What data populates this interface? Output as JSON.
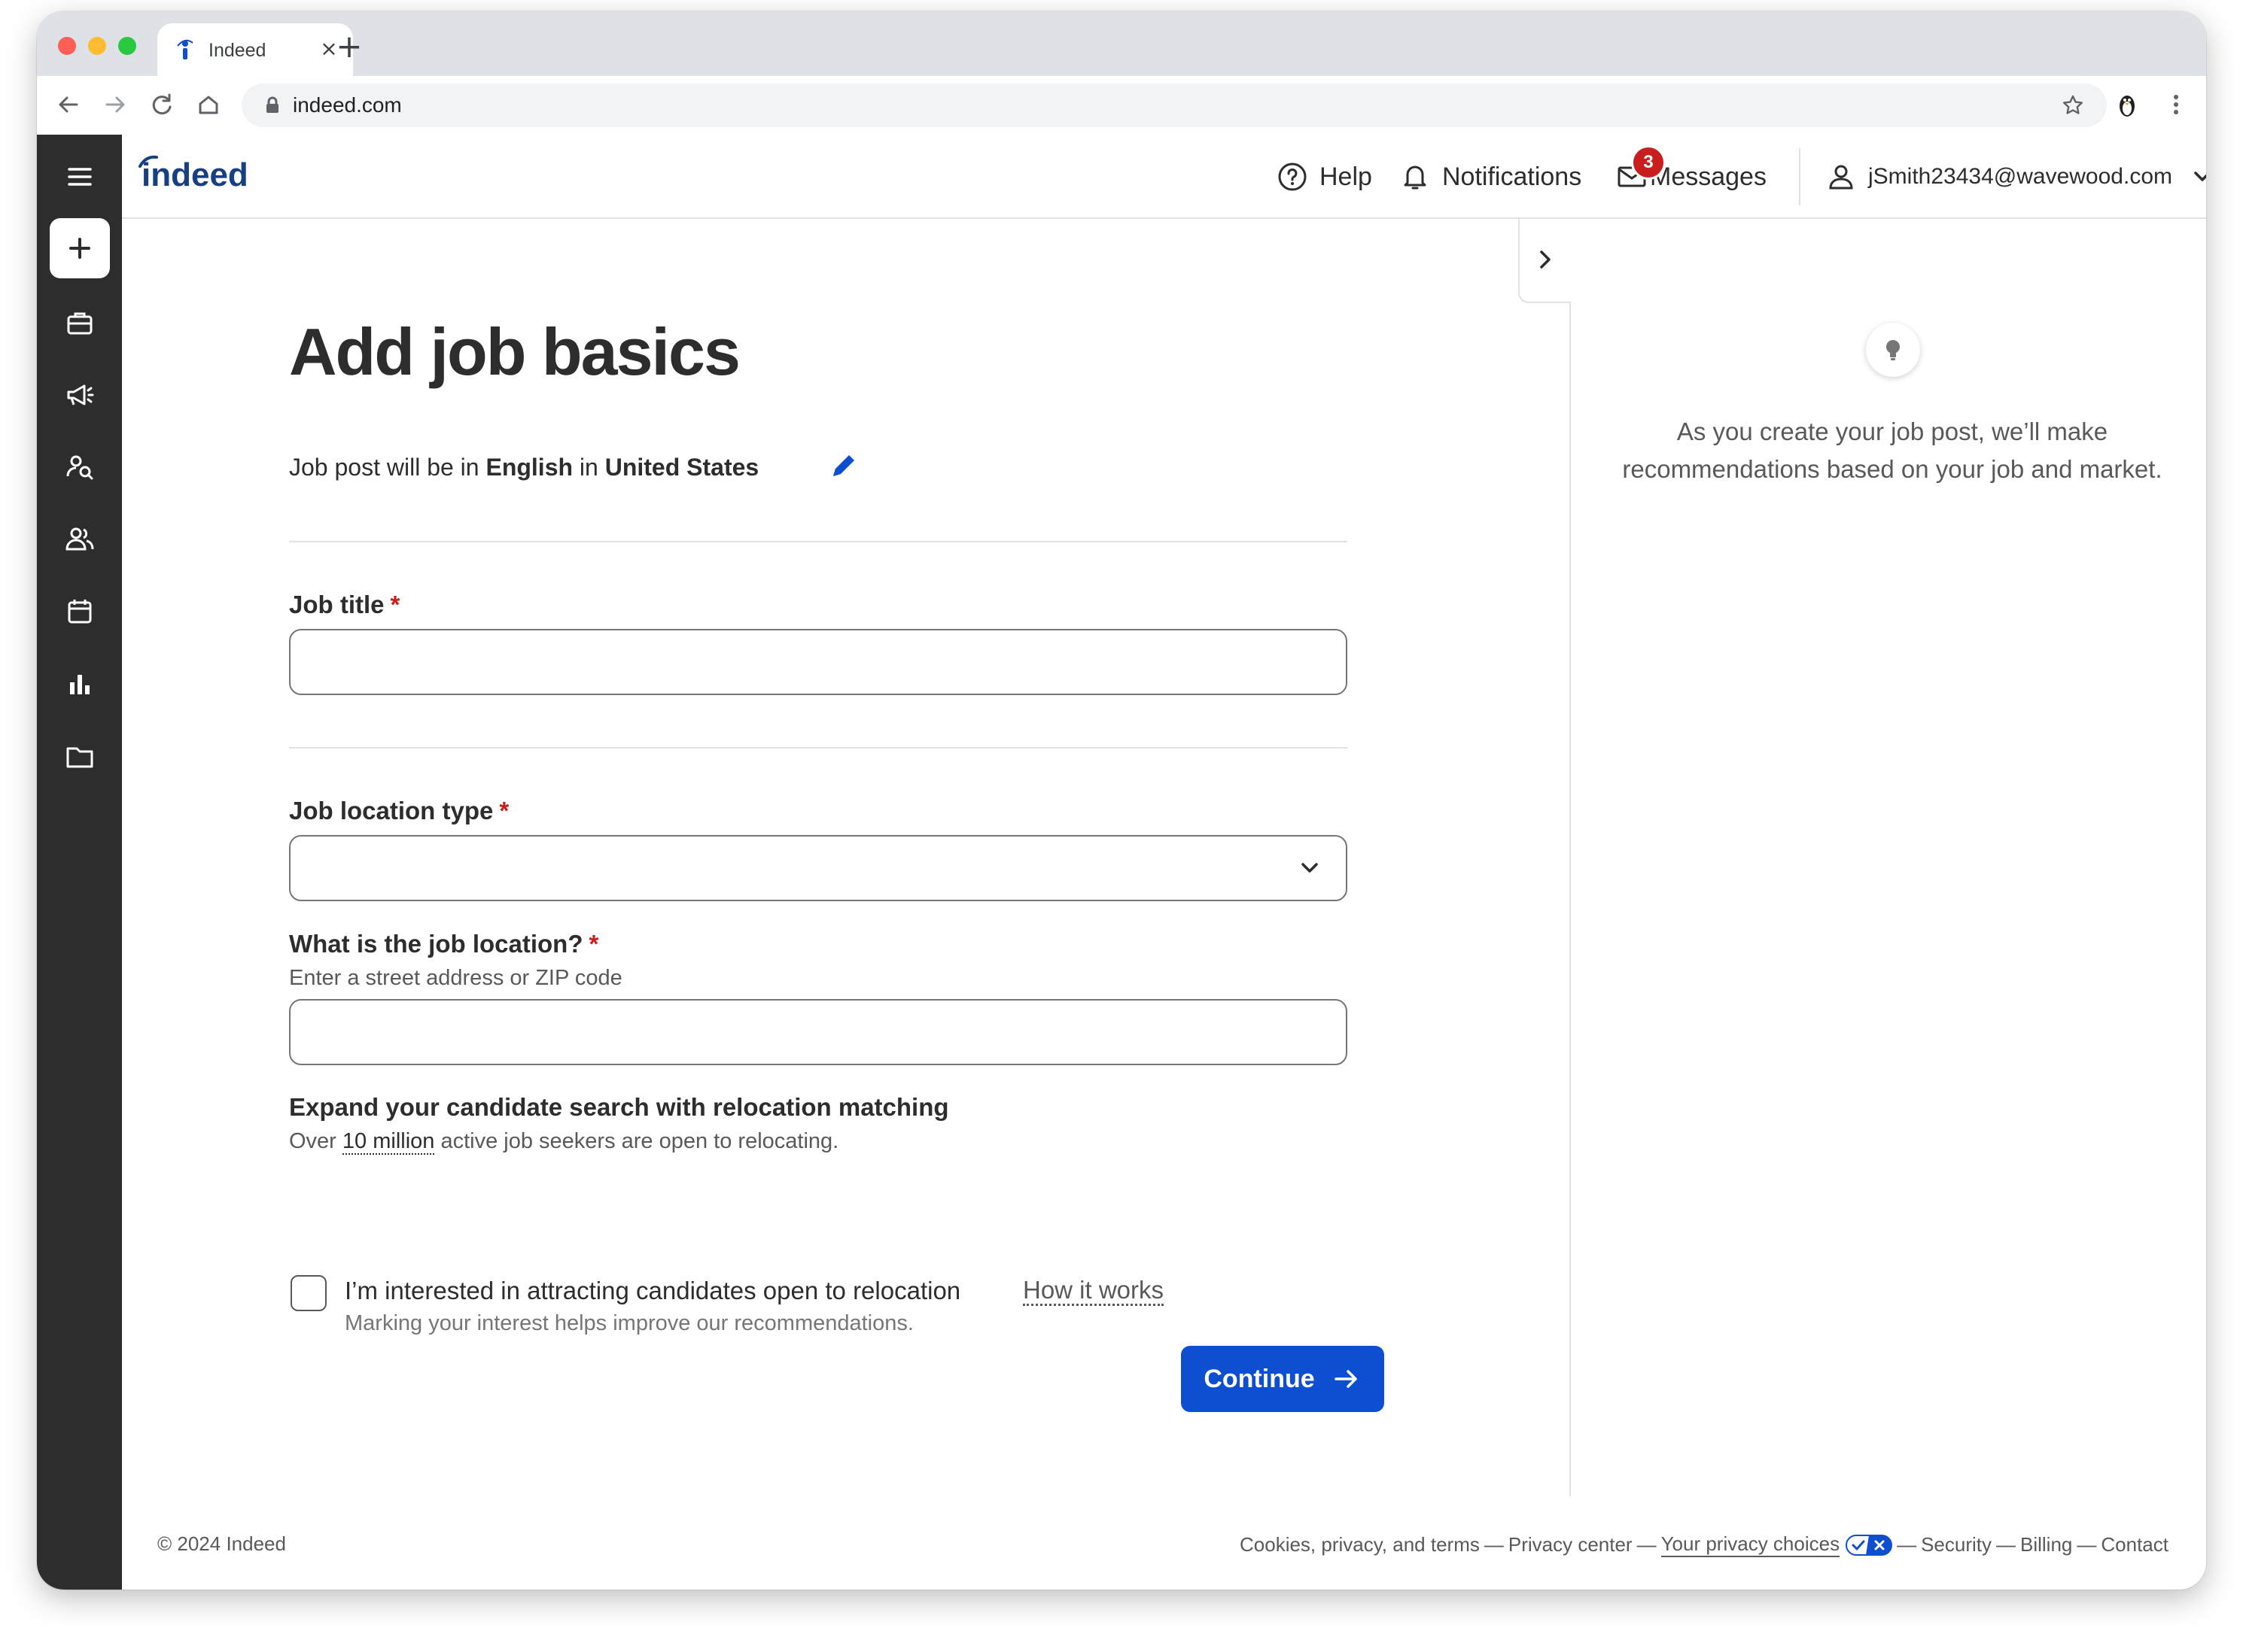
{
  "browser": {
    "tab_title": "Indeed",
    "url": "indeed.com"
  },
  "header": {
    "logo_text": "indeed",
    "help_label": "Help",
    "notifications_label": "Notifications",
    "messages_label": "Messages",
    "messages_count": "3",
    "account_email": "jSmith23434@wavewood.com"
  },
  "sidebar": {
    "items": [
      "menu-icon",
      "plus-icon",
      "briefcase-icon",
      "megaphone-icon",
      "search-person-icon",
      "people-icon",
      "calendar-icon",
      "bar-chart-icon",
      "folder-icon"
    ]
  },
  "main": {
    "title": "Add job basics",
    "lang_prefix": "Job post will be in ",
    "lang_language": "English",
    "lang_mid": " in ",
    "lang_country": "United States",
    "job_title_label": "Job title",
    "job_title_value": "",
    "location_type_label": "Job location type",
    "location_type_value": "",
    "job_location_label": "What is the job location?",
    "job_location_hint": "Enter a street address or ZIP code",
    "job_location_value": "",
    "relocation_heading": "Expand your candidate search with relocation matching",
    "relocation_prefix": "Over ",
    "relocation_highlight": "10 million",
    "relocation_suffix": " active job seekers are open to relocating.",
    "relocation_checkbox_label": "I’m interested in attracting candidates open to relocation",
    "how_it_works": "How it works",
    "relocation_checkbox_sub": "Marking your interest helps improve our recommendations.",
    "required_mark": "*",
    "continue_label": "Continue"
  },
  "rail": {
    "line1": "As you create your job post, we’ll make",
    "line2": "recommendations based on your job and market."
  },
  "footer": {
    "copyright": "© 2024 Indeed",
    "links": [
      "Cookies, privacy, and terms",
      "Privacy center",
      "Your privacy choices",
      "Security",
      "Billing",
      "Contact"
    ],
    "separator": "—"
  },
  "colors": {
    "brand": "#0d4fd0",
    "sidebar": "#2d2d2d",
    "required": "#c81e1e"
  }
}
